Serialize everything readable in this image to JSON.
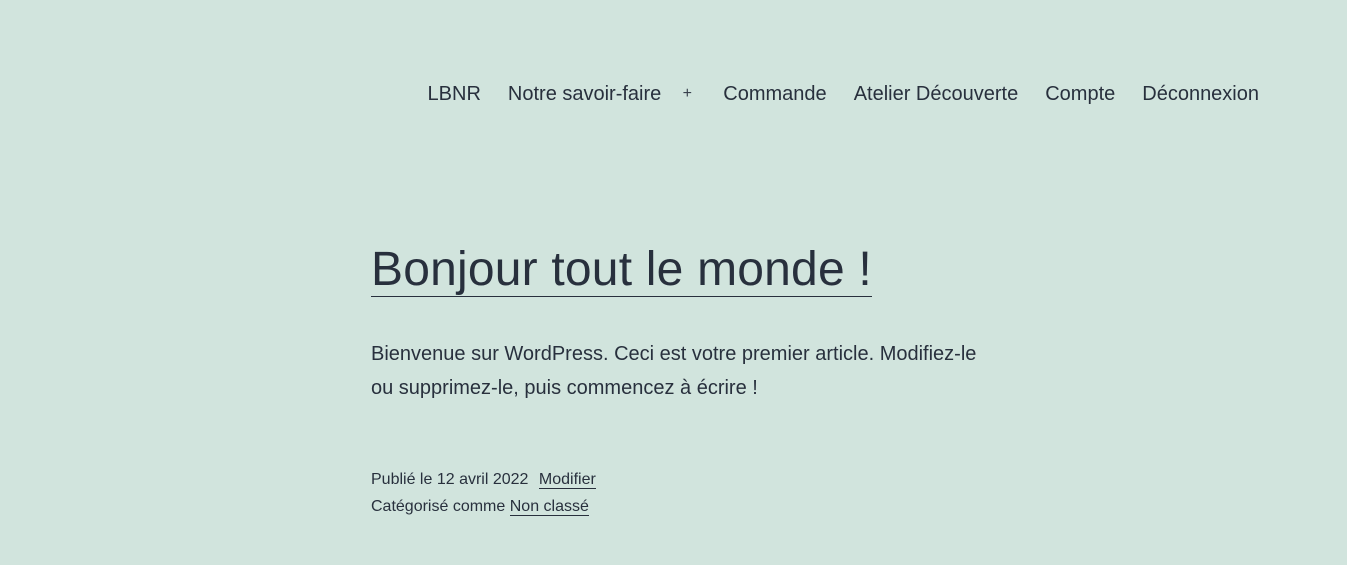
{
  "nav": {
    "items": [
      {
        "label": "LBNR"
      },
      {
        "label": "Notre savoir-faire"
      },
      {
        "label": "Commande"
      },
      {
        "label": "Atelier Découverte"
      },
      {
        "label": "Compte"
      },
      {
        "label": "Déconnexion"
      }
    ],
    "submenu_toggle": "+"
  },
  "post": {
    "title": "Bonjour tout le monde !",
    "content": "Bienvenue sur WordPress. Ceci est votre premier article. Modifiez-le ou supprimez-le, puis commencez à écrire !",
    "published_label": "Publié le",
    "published_date": "12 avril 2022",
    "edit_label": "Modifier",
    "categorized_label": "Catégorisé comme",
    "category": "Non classé"
  },
  "colors": {
    "background": "#d1e4dd",
    "text": "#28303d"
  }
}
